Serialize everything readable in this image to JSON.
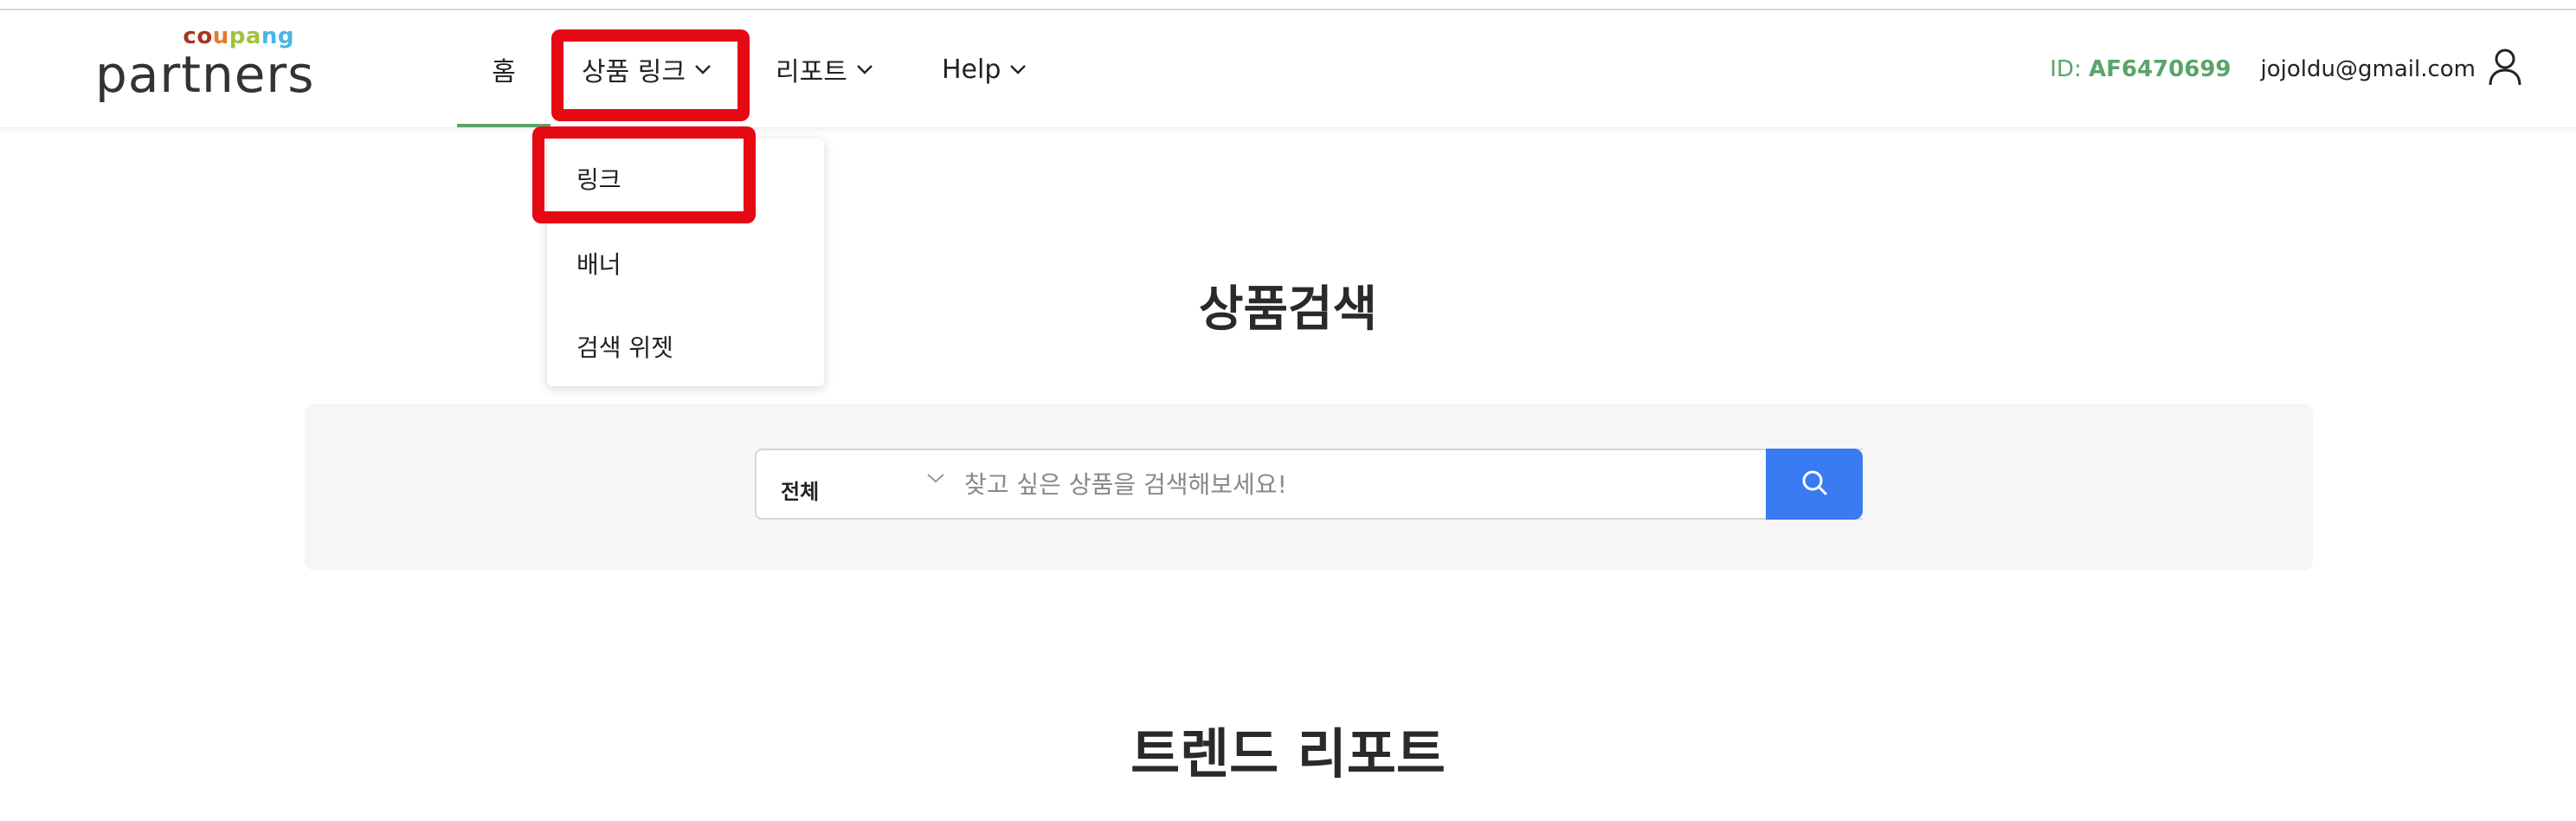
{
  "logo": {
    "brand_parts": [
      "co",
      "u",
      "pa",
      "ng"
    ],
    "wordmark": "partners",
    "colors": [
      "#a6361f",
      "#e57b2c",
      "#a1c33a",
      "#4ab4e6"
    ]
  },
  "nav": {
    "home": "홈",
    "product_link": "상품 링크",
    "report": "리포트",
    "help": "Help",
    "active_color": "#5aa469"
  },
  "dropdown": {
    "items": [
      "링크",
      "배너",
      "검색 위젯"
    ]
  },
  "account": {
    "id_label": "ID:",
    "id_value": "AF6470699",
    "email": "jojoldu@gmail.com",
    "icon": "user-icon"
  },
  "search_section": {
    "title": "상품검색",
    "category": "전체",
    "placeholder": "찾고 싶은 상품을 검색해보세요!",
    "button_icon": "search-icon",
    "button_color": "#3a7af3"
  },
  "trend_section": {
    "title": "트렌드 리포트"
  },
  "highlight_color": "#e50914"
}
